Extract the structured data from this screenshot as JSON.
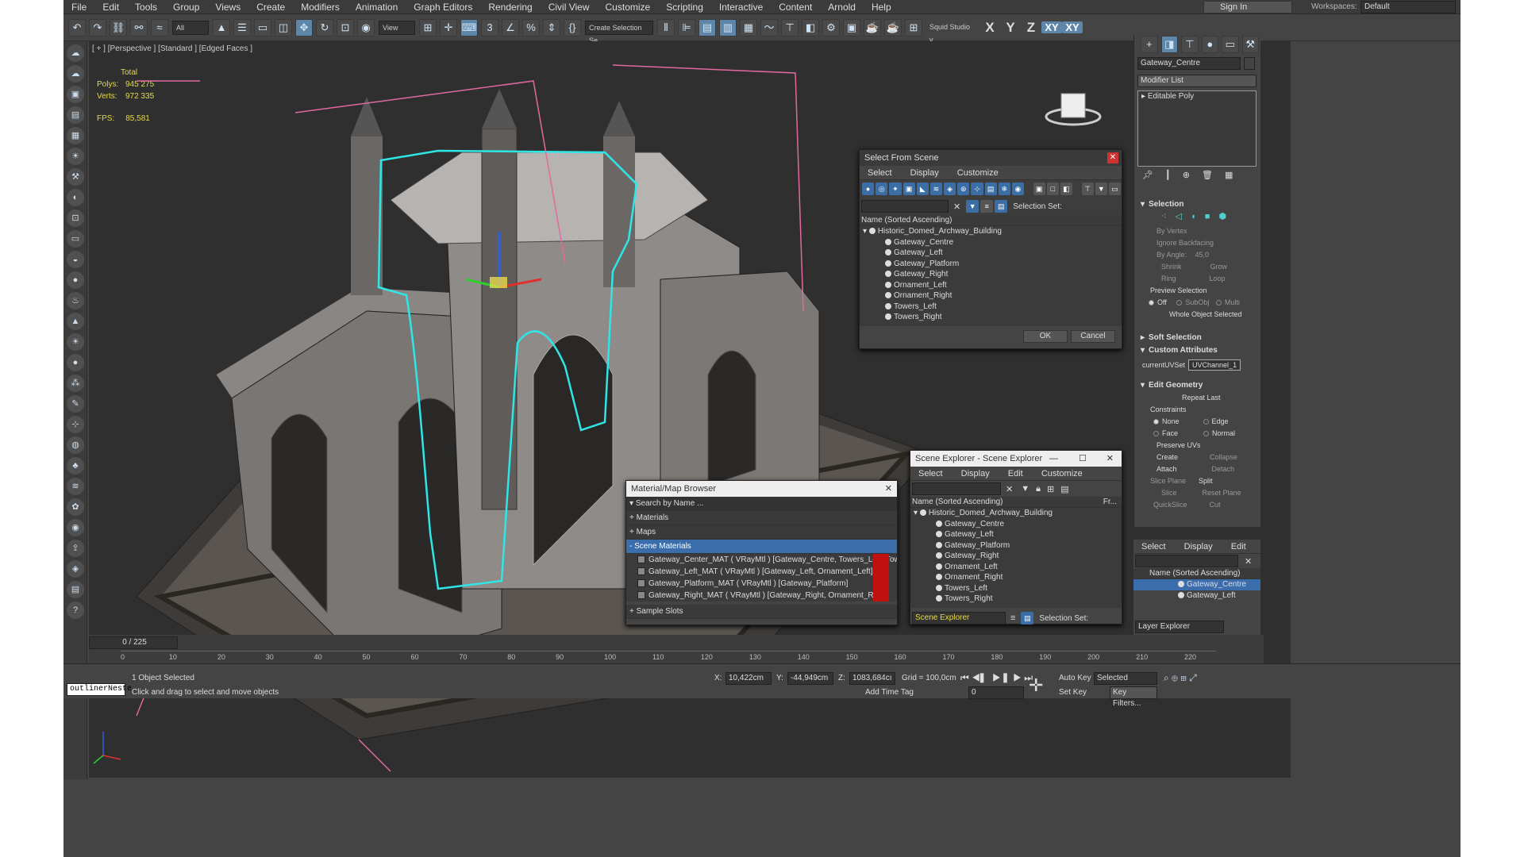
{
  "menu": [
    "File",
    "Edit",
    "Tools",
    "Group",
    "Views",
    "Create",
    "Modifiers",
    "Animation",
    "Graph Editors",
    "Rendering",
    "Civil View",
    "Customize",
    "Scripting",
    "Interactive",
    "Content",
    "Arnold",
    "Help"
  ],
  "signin": "Sign In",
  "workspaces_label": "Workspaces:",
  "workspaces_value": "Default",
  "toolbar": {
    "filter_value": "All",
    "refcoord_value": "View",
    "selection_set_placeholder": "Create Selection Se",
    "studio_label": "Squid Studio v",
    "axes": [
      "X",
      "Y",
      "Z",
      "XY",
      "XY"
    ]
  },
  "viewport": {
    "label": "[ + ] [Perspective ] [Standard ] [Edged Faces ]",
    "stats_header": "Total",
    "polys_label": "Polys:",
    "polys_value": "945 275",
    "verts_label": "Verts:",
    "verts_value": "972 335",
    "fps_label": "FPS:",
    "fps_value": "85,581"
  },
  "select_from_scene": {
    "title": "Select From Scene",
    "menu": [
      "Select",
      "Display",
      "Customize"
    ],
    "selection_set_label": "Selection Set:",
    "column_header": "Name (Sorted Ascending)",
    "root": "Historic_Domed_Archway_Building",
    "items": [
      "Gateway_Centre",
      "Gateway_Left",
      "Gateway_Platform",
      "Gateway_Right",
      "Ornament_Left",
      "Ornament_Right",
      "Towers_Left",
      "Towers_Right"
    ],
    "ok": "OK",
    "cancel": "Cancel"
  },
  "scene_explorer": {
    "title": "Scene Explorer - Scene Explorer",
    "menu": [
      "Select",
      "Display",
      "Edit",
      "Customize"
    ],
    "column_header": "Name (Sorted Ascending)",
    "column_header2": "Fr...",
    "root": "Historic_Domed_Archway_Building",
    "items": [
      "Gateway_Centre",
      "Gateway_Left",
      "Gateway_Platform",
      "Gateway_Right",
      "Ornament_Left",
      "Ornament_Right",
      "Towers_Left",
      "Towers_Right"
    ],
    "footer_select": "Scene Explorer",
    "footer_label": "Selection Set:"
  },
  "material_browser": {
    "title": "Material/Map Browser",
    "search_placeholder": "Search by Name ...",
    "sections": [
      "+ Materials",
      "+ Maps",
      "- Scene Materials",
      "+ Sample Slots"
    ],
    "materials": [
      "Gateway_Center_MAT  ( VRayMtl )  [Gateway_Centre, Towers_Left, Towers_...",
      "Gateway_Left_MAT  ( VRayMtl )  [Gateway_Left, Ornament_Left]",
      "Gateway_Platform_MAT  ( VRayMtl )  [Gateway_Platform]",
      "Gateway_Right_MAT  ( VRayMtl )  [Gateway_Right, Ornament_Right]"
    ]
  },
  "command_panel": {
    "object_name": "Gateway_Centre",
    "modifier_list": "Modifier List",
    "stack_item": "Editable Poly",
    "selection_title": "Selection",
    "by_vertex": "By Vertex",
    "ignore_backfacing": "Ignore Backfacing",
    "by_angle": "By Angle:",
    "by_angle_value": "45,0",
    "shrink": "Shrink",
    "grow": "Grow",
    "ring": "Ring",
    "loop": "Loop",
    "preview_selection": "Preview Selection",
    "preview_off": "Off",
    "preview_subobj": "SubObj",
    "preview_multi": "Multi",
    "whole_object_selected": "Whole Object Selected",
    "soft_selection": "Soft Selection",
    "custom_attributes": "Custom Attributes",
    "current_uvset_label": "currentUVSet",
    "current_uvset_value": "UVChannel_1",
    "edit_geometry": "Edit Geometry",
    "repeat_last": "Repeat Last",
    "constraints": "Constraints",
    "c_none": "None",
    "c_edge": "Edge",
    "c_face": "Face",
    "c_normal": "Normal",
    "preserve_uvs": "Preserve UVs",
    "create": "Create",
    "collapse": "Collapse",
    "attach": "Attach",
    "detach": "Detach",
    "slice_plane": "Slice Plane",
    "split": "Split",
    "slice": "Slice",
    "reset_plane": "Reset Plane",
    "quickslice": "QuickSlice",
    "cut": "Cut"
  },
  "layer_explorer": {
    "menu": [
      "Select",
      "Display",
      "Edit"
    ],
    "column_header": "Name (Sorted Ascending)",
    "items": [
      "Gateway_Centre",
      "Gateway_Left"
    ],
    "footer": "Layer Explorer"
  },
  "timeline": {
    "frame_display": "0 / 225",
    "ticks": [
      "0",
      "10",
      "20",
      "30",
      "40",
      "50",
      "60",
      "70",
      "80",
      "90",
      "100",
      "110",
      "120",
      "130",
      "140",
      "150",
      "160",
      "170",
      "180",
      "190",
      "200",
      "210",
      "220"
    ]
  },
  "status": {
    "script_field": "outlinerNeste",
    "objects_selected": "1 Object Selected",
    "prompt": "Click and drag to select and move objects",
    "x_label": "X:",
    "x_value": "10,422cm",
    "y_label": "Y:",
    "y_value": "-44,949cm",
    "z_label": "Z:",
    "z_value": "1083,684cı",
    "grid": "Grid = 100,0cm",
    "add_time_tag": "Add Time Tag",
    "auto_key": "Auto Key",
    "selected": "Selected",
    "set_key": "Set Key",
    "key_filters": "Key Filters...",
    "frame": "0"
  },
  "colors": {
    "accent": "#5e86a8",
    "selection_outline": "#2ee6e6",
    "bbox": "#e06aa0",
    "stats": "#e6d94a",
    "highlight": "#3b6dad"
  }
}
